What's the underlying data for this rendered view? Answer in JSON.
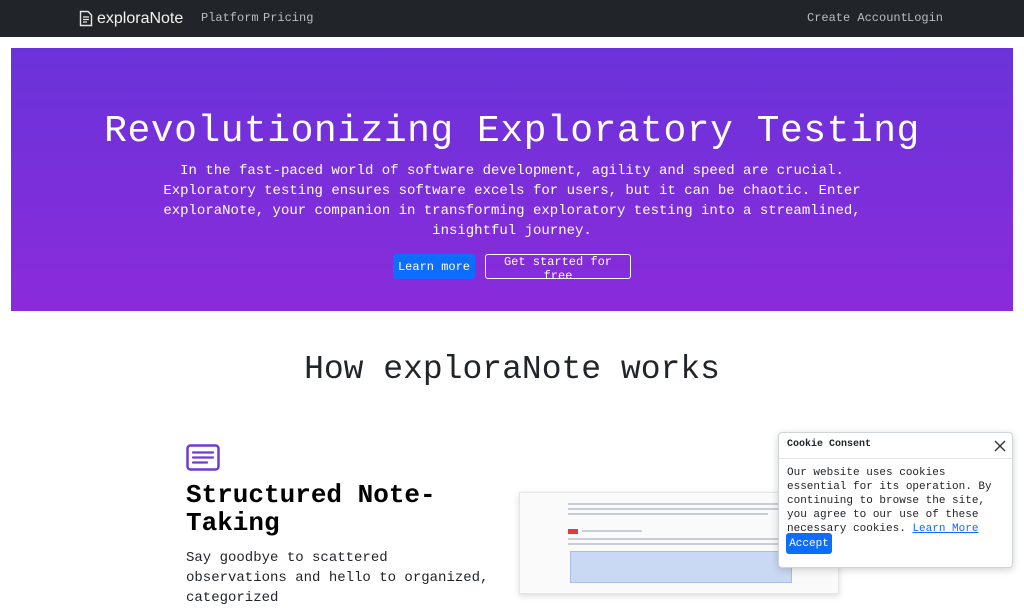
{
  "nav": {
    "brand": "exploraNote",
    "links": [
      {
        "label": "Platform"
      },
      {
        "label": "Pricing"
      }
    ],
    "right_links": [
      {
        "label": "Create Account"
      },
      {
        "label": "Login"
      }
    ]
  },
  "hero": {
    "title": "Revolutionizing Exploratory Testing",
    "description": "In the fast-paced world of software development, agility and speed are crucial. Exploratory testing ensures software excels for users, but it can be chaotic. Enter exploraNote, your companion in transforming exploratory testing into a streamlined, insightful journey.",
    "learn_more_label": "Learn more",
    "get_started_label": "Get started for free"
  },
  "how": {
    "title": "How exploraNote works",
    "feature": {
      "icon": "notes-icon",
      "title": "Structured Note-Taking",
      "description": "Say goodbye to scattered observations and hello to organized, categorized"
    }
  },
  "cookie": {
    "title": "Cookie Consent",
    "body": "Our website uses cookies essential for its operation. By continuing to browse the site, you agree to our use of these necessary cookies.",
    "learn_more_label": "Learn More",
    "accept_label": "Accept"
  },
  "colors": {
    "nav_bg": "#212529",
    "hero_gradient_start": "#6a33d9",
    "hero_gradient_end": "#8a2bdb",
    "primary": "#0d6efd",
    "feature_icon": "#6f3bd2"
  }
}
